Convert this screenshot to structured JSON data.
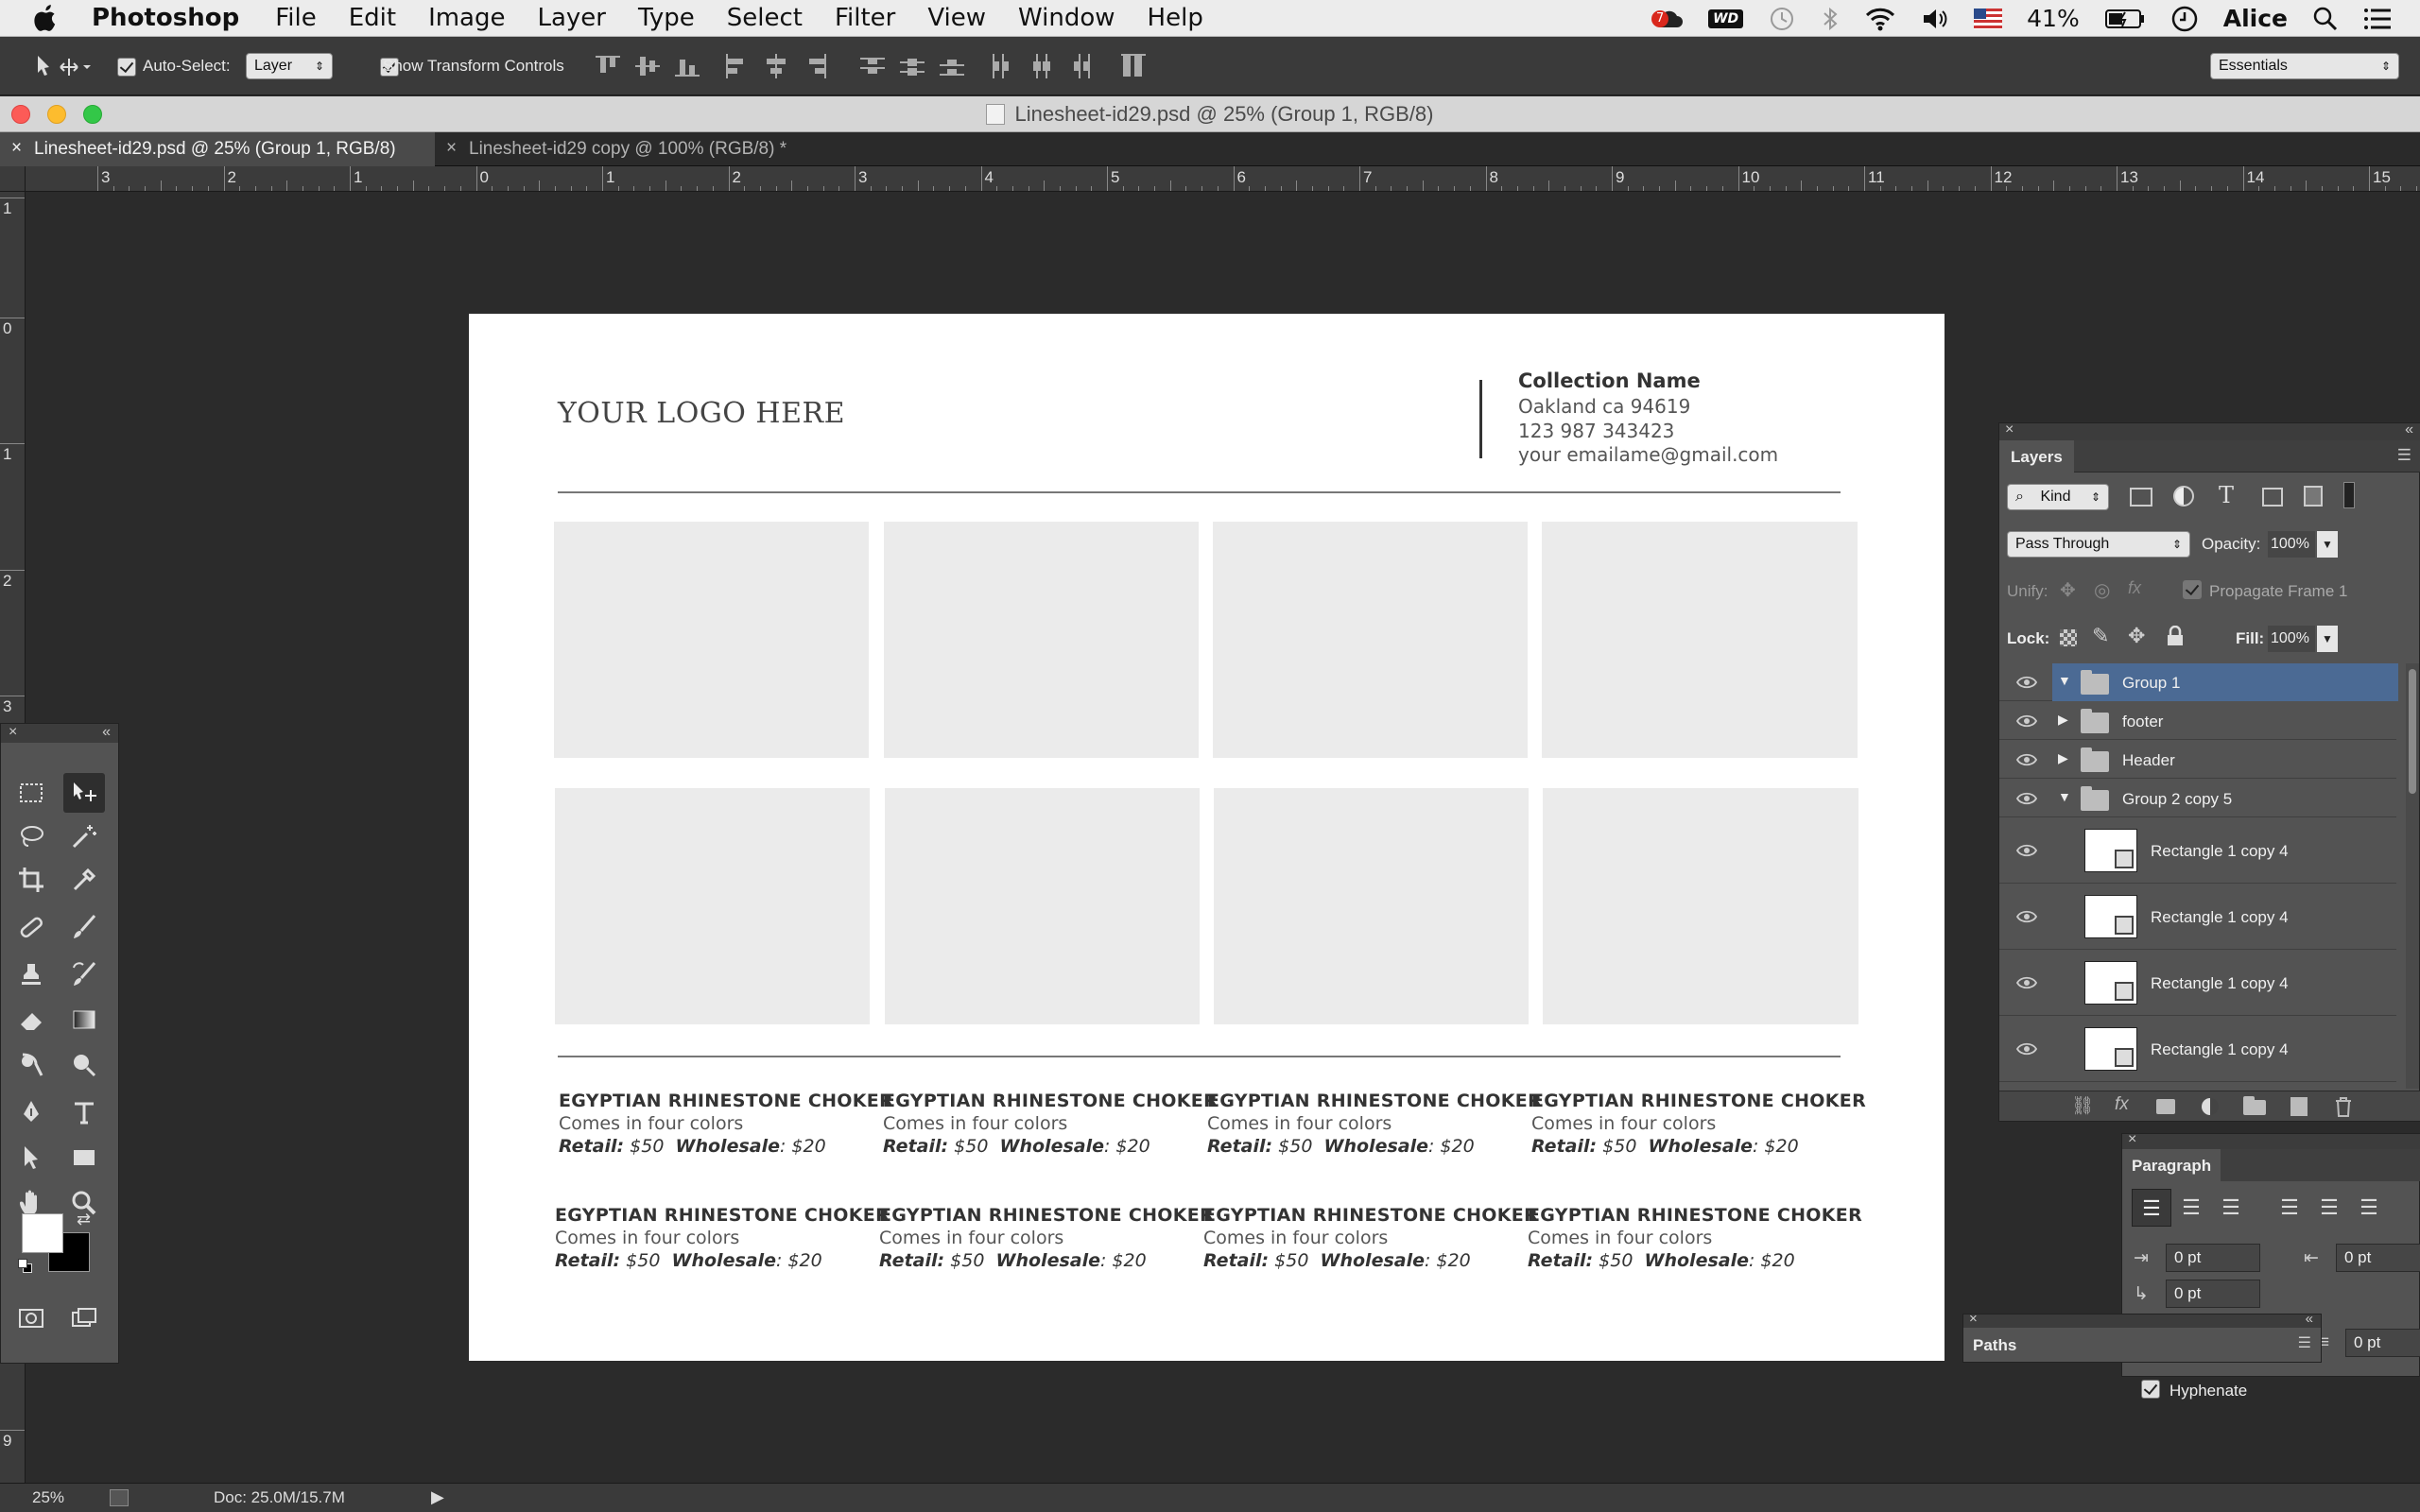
{
  "menubar": {
    "app": "Photoshop",
    "items": [
      "File",
      "Edit",
      "Image",
      "Layer",
      "Type",
      "Select",
      "Filter",
      "View",
      "Window",
      "Help"
    ],
    "battery": "41%",
    "user": "Alice",
    "wd_badge": "WD",
    "notif_count": "7"
  },
  "options": {
    "auto_select_label": "Auto-Select:",
    "auto_select_value": "Layer",
    "transform_label": "Show Transform Controls",
    "workspace": "Essentials"
  },
  "window": {
    "title": "Linesheet-id29.psd @ 25% (Group 1, RGB/8)"
  },
  "tabs": [
    {
      "label": "Linesheet-id29.psd @ 25% (Group 1, RGB/8)",
      "close": "×"
    },
    {
      "label": "Linesheet-id29 copy @ 100% (RGB/8) *",
      "close": "×"
    }
  ],
  "hruler_labels": [
    "3",
    "2",
    "1",
    "0",
    "1",
    "2",
    "3",
    "4",
    "5",
    "6",
    "7",
    "8",
    "9",
    "10",
    "11",
    "12",
    "13",
    "14",
    "15"
  ],
  "vruler_labels": [
    "1",
    "0",
    "1",
    "2",
    "3",
    "9"
  ],
  "document": {
    "logo": "YOUR LOGO HERE",
    "collection_name": "Collection Name",
    "address": "Oakland ca 94619",
    "phone": "123 987 343423",
    "email": "your emailame@gmail.com",
    "products": [
      {
        "title": "EGYPTIAN RHINESTONE CHOKER",
        "desc": "Comes in four colors",
        "retail_label": "Retail:",
        "retail": "$50",
        "wholesale_label": "Wholesale",
        "wholesale": ": $20"
      },
      {
        "title": "EGYPTIAN RHINESTONE CHOKER",
        "desc": "Comes in four colors",
        "retail_label": "Retail:",
        "retail": "$50",
        "wholesale_label": "Wholesale",
        "wholesale": ": $20"
      },
      {
        "title": "EGYPTIAN RHINESTONE CHOKER",
        "desc": "Comes in four colors",
        "retail_label": "Retail:",
        "retail": "$50",
        "wholesale_label": "Wholesale",
        "wholesale": ": $20"
      },
      {
        "title": "EGYPTIAN RHINESTONE CHOKER",
        "desc": "Comes in four colors",
        "retail_label": "Retail:",
        "retail": "$50",
        "wholesale_label": "Wholesale",
        "wholesale": ": $20"
      },
      {
        "title": "EGYPTIAN RHINESTONE CHOKER",
        "desc": "Comes in four colors",
        "retail_label": "Retail:",
        "retail": "$50",
        "wholesale_label": "Wholesale",
        "wholesale": ": $20"
      },
      {
        "title": "EGYPTIAN RHINESTONE CHOKER",
        "desc": "Comes in four colors",
        "retail_label": "Retail:",
        "retail": "$50",
        "wholesale_label": "Wholesale",
        "wholesale": ": $20"
      },
      {
        "title": "EGYPTIAN RHINESTONE CHOKER",
        "desc": "Comes in four colors",
        "retail_label": "Retail:",
        "retail": "$50",
        "wholesale_label": "Wholesale",
        "wholesale": ": $20"
      },
      {
        "title": "EGYPTIAN RHINESTONE CHOKER",
        "desc": "Comes in four colors",
        "retail_label": "Retail:",
        "retail": "$50",
        "wholesale_label": "Wholesale",
        "wholesale": ": $20"
      }
    ]
  },
  "layers_panel": {
    "tab": "Layers",
    "filter": "Kind",
    "blend_mode": "Pass Through",
    "opacity_label": "Opacity:",
    "opacity": "100%",
    "unify_label": "Unify:",
    "propagate": "Propagate Frame 1",
    "lock_label": "Lock:",
    "fill_label": "Fill:",
    "fill": "100%",
    "layers": [
      {
        "name": "Group 1",
        "selected": true
      },
      {
        "name": "footer"
      },
      {
        "name": "Header"
      },
      {
        "name": "Group 2 copy 5"
      },
      {
        "name": "Rectangle 1 copy 4"
      },
      {
        "name": "Rectangle 1 copy 4"
      },
      {
        "name": "Rectangle 1 copy 4"
      },
      {
        "name": "Rectangle 1 copy 4"
      }
    ]
  },
  "paragraph_panel": {
    "tab": "Paragraph",
    "indent_left": "0 pt",
    "indent_right": "0 pt",
    "indent_first": "0 pt",
    "space_after": "0 pt",
    "hyphenate": "Hyphenate"
  },
  "paths_panel": {
    "tab": "Paths"
  },
  "status": {
    "zoom": "25%",
    "doc": "Doc: 25.0M/15.7M"
  },
  "colors": {
    "selection": "#4b6a94",
    "canvas_bg": "#2b2b2b",
    "panel_bg": "#535353"
  }
}
